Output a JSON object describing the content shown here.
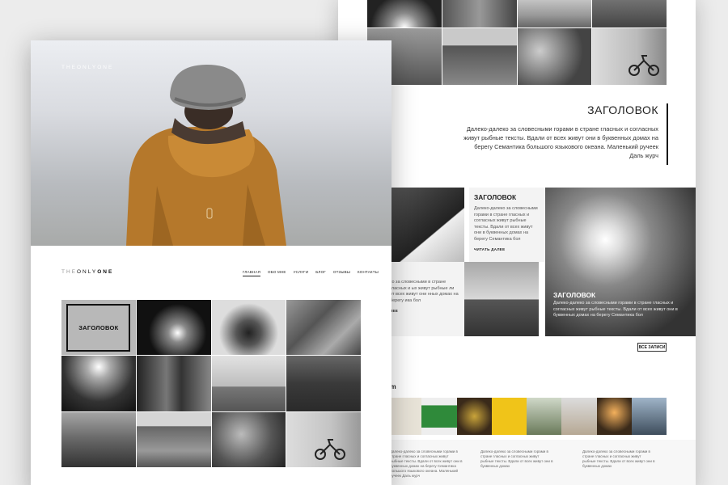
{
  "back_page": {
    "heading": "ЗАГОЛОВОК",
    "intro": "Далеко-далеко за словесными горами в стране гласных и согласных живут рыбные тексты. Вдали от всех живут они в буквенных домах на берегу Семантика большого языкового океана. Маленький ручеек Даль журч",
    "posts": [
      {
        "title": "ЗАГОЛОВОК",
        "body": "Далеко-далеко за словесными горами в стране гласных и согласных живут рыбные тексты. Вдали от всех живут они в буквенных домах на берегу Семантика бол",
        "more": "ЧИТАТЬ ДАЛЕЕ"
      },
      {
        "title": "",
        "body": "ко за словесными в стране гласных и ых живут рыбные ли от всех живут они нных домах на берегу ика бол",
        "more": "ЛЕЕ"
      },
      {
        "title": "ЗАГОЛОВОК",
        "body": "Далеко-далеко за словесными горами в стране гласных и согласных живут рыбные тексты. Вдали от всех живут они в буквенных домах на берегу Семантика бол",
        "more": ""
      }
    ],
    "all_posts_button": "ВСЕ ЗАПИСИ",
    "instagram_label": "am",
    "footer_columns": [
      "Далеко-далеко за словесными горами в стране гласных и согласных живут рыбные тексты. Вдали от всех живут они в буквенных домах на берегу Семантика большого языкового океана. Маленький ручеек Даль журч",
      "Далеко-далеко за словесными горами в стране гласных и согласных живут рыбные тексты. Вдали от всех живут они в буквенных домах",
      "Далеко-далеко за словесными горами в стране гласных и согласных живут рыбные тексты. Вдали от всех живут они в буквенных домах"
    ]
  },
  "front_page": {
    "hero_logo": "THEONLYONE",
    "nav_logo_light": "THE",
    "nav_logo_mid": "ONLY",
    "nav_logo_bold": "ONE",
    "nav": [
      "ГЛАВНАЯ",
      "ОБО МНЕ",
      "УСЛУГИ",
      "БЛОГ",
      "ОТЗЫВЫ",
      "КОНТАКТЫ"
    ],
    "grid_title": "ЗАГОЛОВОК"
  },
  "colors": {
    "accent": "#111111",
    "jacket": "#b5782b",
    "hat": "#8a8a8a"
  }
}
